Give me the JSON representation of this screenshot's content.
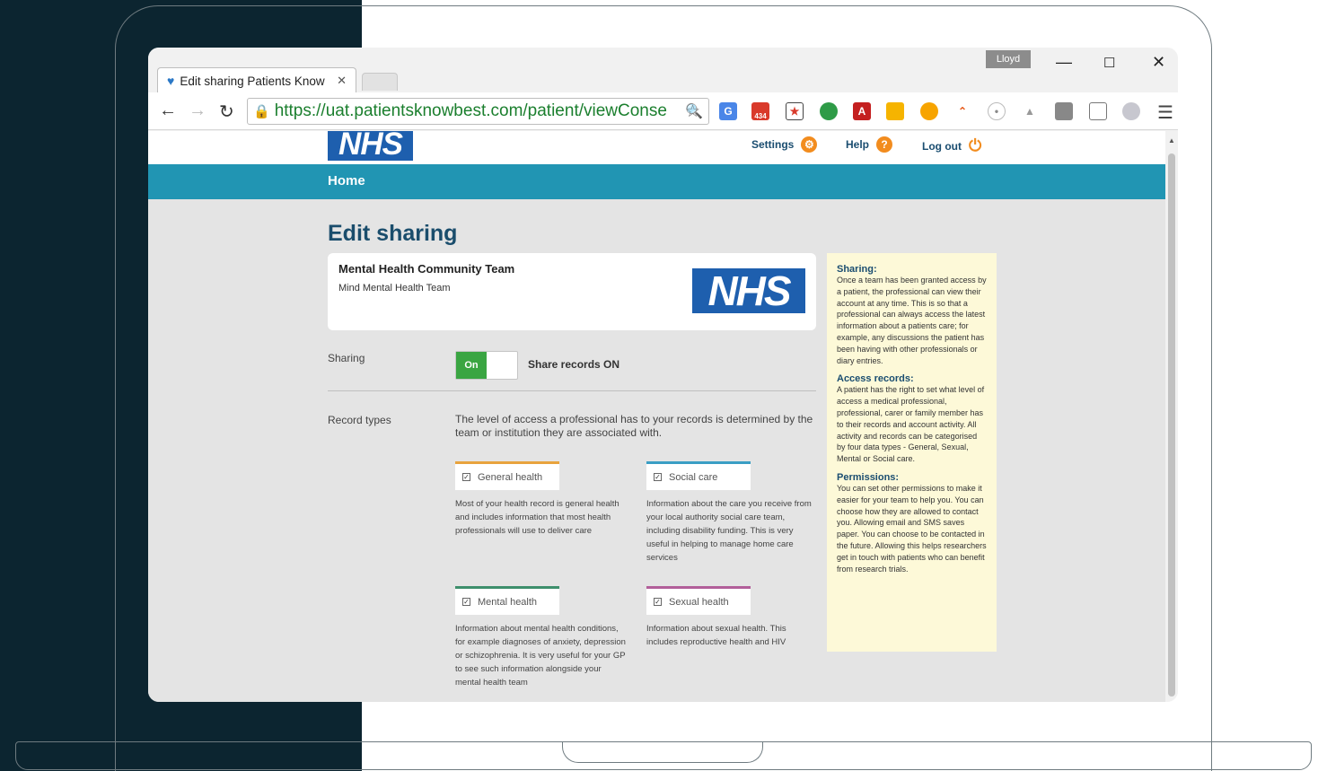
{
  "browser": {
    "tab_title": "Edit sharing Patients Know",
    "user_badge": "Lloyd",
    "url": "https://uat.patientsknowbest.com/patient/viewConse",
    "extension_badge": "434"
  },
  "header": {
    "logo_text": "NHS",
    "settings_label": "Settings",
    "help_label": "Help",
    "logout_label": "Log out"
  },
  "nav": {
    "home_label": "Home"
  },
  "main": {
    "page_title": "Edit sharing",
    "team": {
      "name": "Mental Health Community Team",
      "subtitle": "Mind Mental Health Team",
      "logo_text": "NHS"
    },
    "sharing": {
      "label": "Sharing",
      "toggle_label": "On",
      "status": "Share records ON"
    },
    "record_types": {
      "label": "Record types",
      "intro": "The level of access a professional has to your records is determined by the team or institution they are associated with.",
      "items": [
        {
          "label": "General health",
          "color": "#e8a33d",
          "description": "Most of your health record is general health and includes information that most health professionals will use to deliver care"
        },
        {
          "label": "Social care",
          "color": "#3a9ec4",
          "description": "Information about the care you receive from your local authority social care team, including disability funding. This is very useful in helping to manage home care services"
        },
        {
          "label": "Mental health",
          "color": "#3e8f6c",
          "description": "Information about mental health conditions, for example diagnoses of anxiety, depression or schizophrenia. It is very useful for your GP to see such information alongside your mental health team"
        },
        {
          "label": "Sexual health",
          "color": "#b25f9a",
          "description": "Information about sexual health. This includes reproductive health and HIV"
        }
      ]
    }
  },
  "sidebar": {
    "sections": [
      {
        "heading": "Sharing:",
        "text": "Once a team has been granted access by a patient, the professional can view their account at any time. This is so that a professional can always access the latest information about a patients care; for example, any discussions the patient has been having with other professionals or diary entries."
      },
      {
        "heading": "Access records:",
        "text": "A patient has the right to set what level of access a medical professional, professional, carer or family member has to their records and account activity. All activity and records can be categorised by four data types - General, Sexual, Mental or Social care."
      },
      {
        "heading": "Permissions:",
        "text": "You can set other permissions to make it easier for your team to help you. You can choose how they are allowed to contact you. Allowing email and SMS saves paper. You can choose to be contacted in the future. Allowing this helps researchers get in touch with patients who can benefit from research trials."
      }
    ]
  }
}
